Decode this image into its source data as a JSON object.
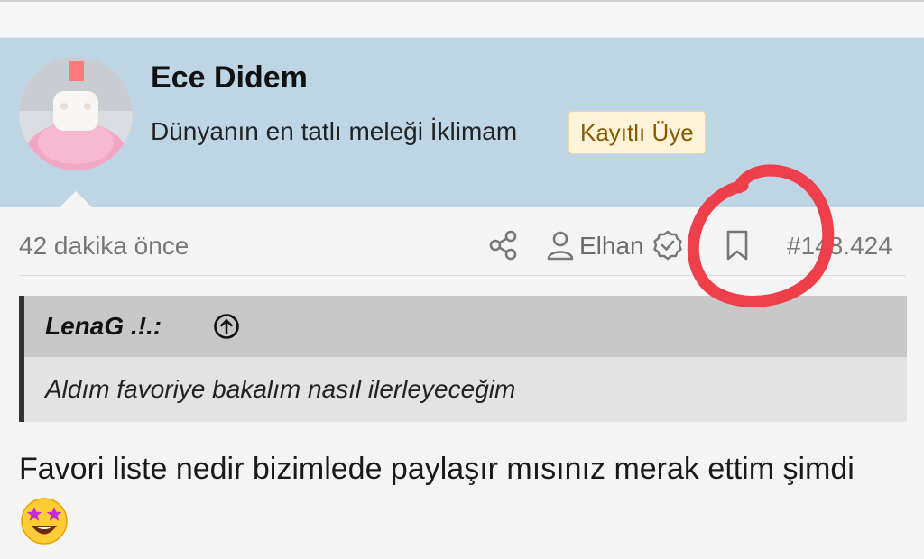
{
  "user": {
    "name": "Ece Didem",
    "subtitle": "Dünyanın en tatlı meleği İklimam",
    "role_badge": "Kayıtlı Üye"
  },
  "post_meta": {
    "time": "42 dakika önce",
    "author": "Elhan",
    "post_number": "#148.424"
  },
  "quote": {
    "author": "LenaG .!.:",
    "text": "Aldım favoriye bakalım nasıl ilerleyeceğim"
  },
  "message": {
    "text": "Favori liste nedir bizimlede paylaşır mısınız merak ettim şimdi"
  },
  "icons": {
    "share": "share-icon",
    "user": "user-icon",
    "verified": "verified-icon",
    "bookmark": "bookmark-icon",
    "quote_jump": "arrow-up-circle-icon",
    "emoji": "star-struck-emoji"
  },
  "colors": {
    "header_bg": "#bed5e5",
    "badge_bg": "#fdf3d8",
    "badge_text": "#8a5a00",
    "annotation_red": "#ef3f4b"
  }
}
